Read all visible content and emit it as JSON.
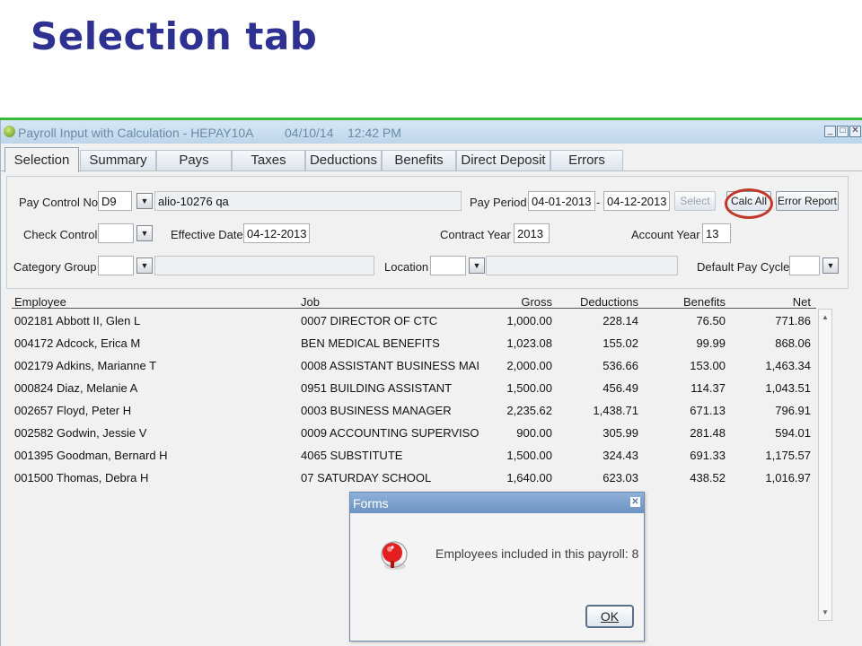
{
  "slide": {
    "title": "Selection tab"
  },
  "window": {
    "title": "Payroll Input with Calculation - HEPAY10A",
    "date": "04/10/14",
    "time": "12:42 PM",
    "controls": {
      "minimize": "_",
      "restore": "□",
      "close": "✕"
    }
  },
  "tabs": [
    {
      "label": "Selection",
      "active": true
    },
    {
      "label": "Summary"
    },
    {
      "label": "Pays"
    },
    {
      "label": "Taxes"
    },
    {
      "label": "Deductions"
    },
    {
      "label": "Benefits"
    },
    {
      "label": "Direct Deposit"
    },
    {
      "label": "Errors"
    }
  ],
  "form": {
    "pay_control_no": {
      "label": "Pay Control No",
      "value": "D9",
      "description": "alio-10276 qa"
    },
    "pay_period": {
      "label": "Pay Period",
      "from": "04-01-2013",
      "separator": "-",
      "to": "04-12-2013"
    },
    "buttons": {
      "select": "Select",
      "calc_all": "Calc All",
      "error_report": "Error Report"
    },
    "check_control": {
      "label": "Check Control",
      "value": ""
    },
    "effective_date": {
      "label": "Effective Date",
      "value": "04-12-2013"
    },
    "contract_year": {
      "label": "Contract Year",
      "value": "2013"
    },
    "account_year": {
      "label": "Account Year",
      "value": "13"
    },
    "category_group": {
      "label": "Category Group",
      "value": "",
      "description": ""
    },
    "location": {
      "label": "Location",
      "value": "",
      "description": ""
    },
    "default_pay_cycle": {
      "label": "Default Pay Cycle",
      "value": ""
    },
    "dropdown_glyph": "▼"
  },
  "grid": {
    "headers": {
      "employee": "Employee",
      "job": "Job",
      "gross": "Gross",
      "deductions": "Deductions",
      "benefits": "Benefits",
      "net": "Net"
    },
    "rows": [
      {
        "employee": "002181 Abbott II, Glen L",
        "job": "0007 DIRECTOR OF CTC",
        "gross": "1,000.00",
        "deductions": "228.14",
        "benefits": "76.50",
        "net": "771.86"
      },
      {
        "employee": "004172 Adcock, Erica M",
        "job": "BEN MEDICAL BENEFITS",
        "gross": "1,023.08",
        "deductions": "155.02",
        "benefits": "99.99",
        "net": "868.06"
      },
      {
        "employee": "002179 Adkins, Marianne T",
        "job": "0008 ASSISTANT BUSINESS MAI",
        "gross": "2,000.00",
        "deductions": "536.66",
        "benefits": "153.00",
        "net": "1,463.34"
      },
      {
        "employee": "000824 Diaz, Melanie A",
        "job": "0951 BUILDING ASSISTANT",
        "gross": "1,500.00",
        "deductions": "456.49",
        "benefits": "114.37",
        "net": "1,043.51"
      },
      {
        "employee": "002657 Floyd, Peter H",
        "job": "0003 BUSINESS MANAGER",
        "gross": "2,235.62",
        "deductions": "1,438.71",
        "benefits": "671.13",
        "net": "796.91"
      },
      {
        "employee": "002582 Godwin, Jessie V",
        "job": "0009 ACCOUNTING SUPERVISO",
        "gross": "900.00",
        "deductions": "305.99",
        "benefits": "281.48",
        "net": "594.01"
      },
      {
        "employee": "001395 Goodman, Bernard H",
        "job": "4065 SUBSTITUTE",
        "gross": "1,500.00",
        "deductions": "324.43",
        "benefits": "691.33",
        "net": "1,175.57"
      },
      {
        "employee": "001500 Thomas, Debra H",
        "job": "07 SATURDAY SCHOOL",
        "gross": "1,640.00",
        "deductions": "623.03",
        "benefits": "438.52",
        "net": "1,016.97"
      }
    ],
    "scroll_up": "▲",
    "scroll_down": "▼"
  },
  "dialog": {
    "title": "Forms",
    "close": "✕",
    "message": "Employees included in this payroll: 8",
    "ok_label": "OK"
  },
  "colors": {
    "title_blue": "#2e3192",
    "accent_green": "#3cb83c",
    "highlight_red": "#c0392b",
    "dialog_titlebar": "#7aa0cc"
  }
}
